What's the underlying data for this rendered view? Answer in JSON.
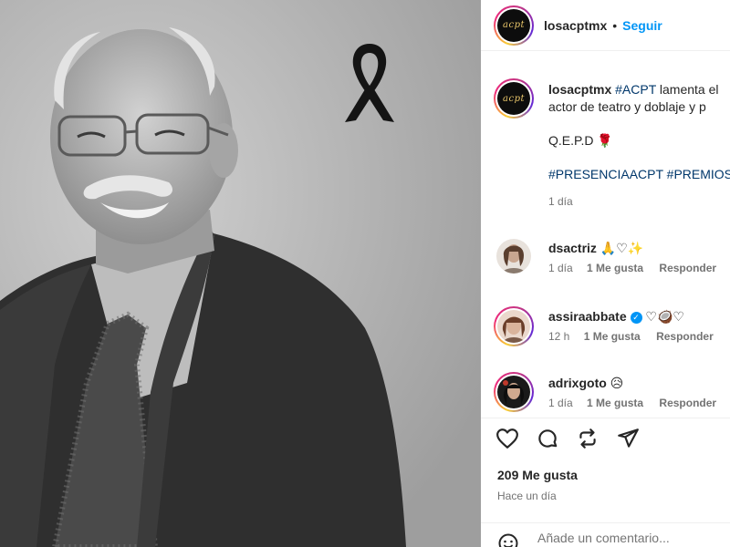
{
  "post": {
    "author": "losacptmx",
    "logo_text": "acpt",
    "follow_label": "Seguir",
    "header_separator": "•"
  },
  "caption": {
    "username": "losacptmx",
    "hashtag_acpt": "#ACPT",
    "line1_rest": "lamenta el",
    "line2": "actor de teatro y doblaje y p",
    "qepd": "Q.E.P.D 🌹",
    "hashtags": "#PRESENCIAACPT #PREMIOS",
    "time": "1 día"
  },
  "comments": [
    {
      "username": "dsactriz",
      "text": "🙏♡✨",
      "time": "1 día",
      "likes": "1 Me gusta",
      "reply": "Responder"
    },
    {
      "username": "assiraabbate",
      "verified": true,
      "text": "♡🥥♡",
      "time": "12 h",
      "likes": "1 Me gusta",
      "reply": "Responder"
    },
    {
      "username": "adrixgoto",
      "text": "😥",
      "time": "1 día",
      "likes": "1 Me gusta",
      "reply": "Responder"
    }
  ],
  "actions": {
    "like_icon": "heart-icon",
    "comment_icon": "comment-icon",
    "share_icon": "repost-icon",
    "send_icon": "send-icon",
    "likes": "209 Me gusta",
    "posted": "Hace un día"
  },
  "composer": {
    "placeholder": "Añade un comentario..."
  },
  "colors": {
    "link_blue": "#0095f6",
    "hashtag": "#00376b",
    "muted": "#737373"
  }
}
